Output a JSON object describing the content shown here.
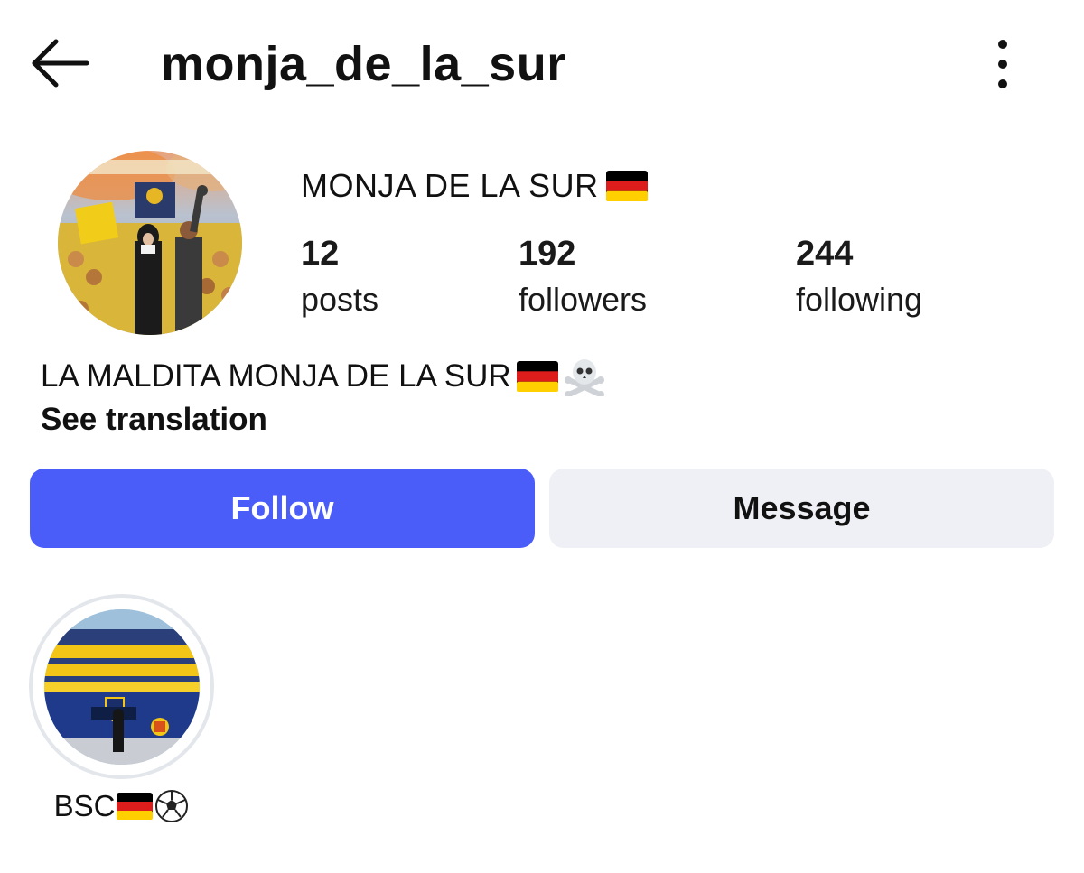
{
  "header": {
    "username": "monja_de_la_sur",
    "back_icon": "arrow-left-icon",
    "more_icon": "more-vertical-icon"
  },
  "profile": {
    "display_name": "MONJA DE LA SUR",
    "display_name_flag": "germany-flag-icon",
    "avatar_icon": "profile-avatar-photo"
  },
  "stats": {
    "posts": {
      "count": "12",
      "label": "posts"
    },
    "followers": {
      "count": "192",
      "label": "followers"
    },
    "following": {
      "count": "244",
      "label": "following"
    }
  },
  "bio": {
    "text": "LA MALDITA MONJA DE LA SUR",
    "emoji_flag": "germany-flag-icon",
    "emoji_skull": "skull-crossbones-icon",
    "see_translation": "See translation"
  },
  "actions": {
    "follow_label": "Follow",
    "message_label": "Message"
  },
  "highlights": [
    {
      "label": "BSC",
      "icons": [
        "germany-flag-icon",
        "soccer-ball-icon"
      ]
    }
  ],
  "colors": {
    "follow_button": "#4a5df9",
    "message_button": "#eff0f5",
    "text": "#111111",
    "highlight_ring": "#e3e7ec"
  }
}
